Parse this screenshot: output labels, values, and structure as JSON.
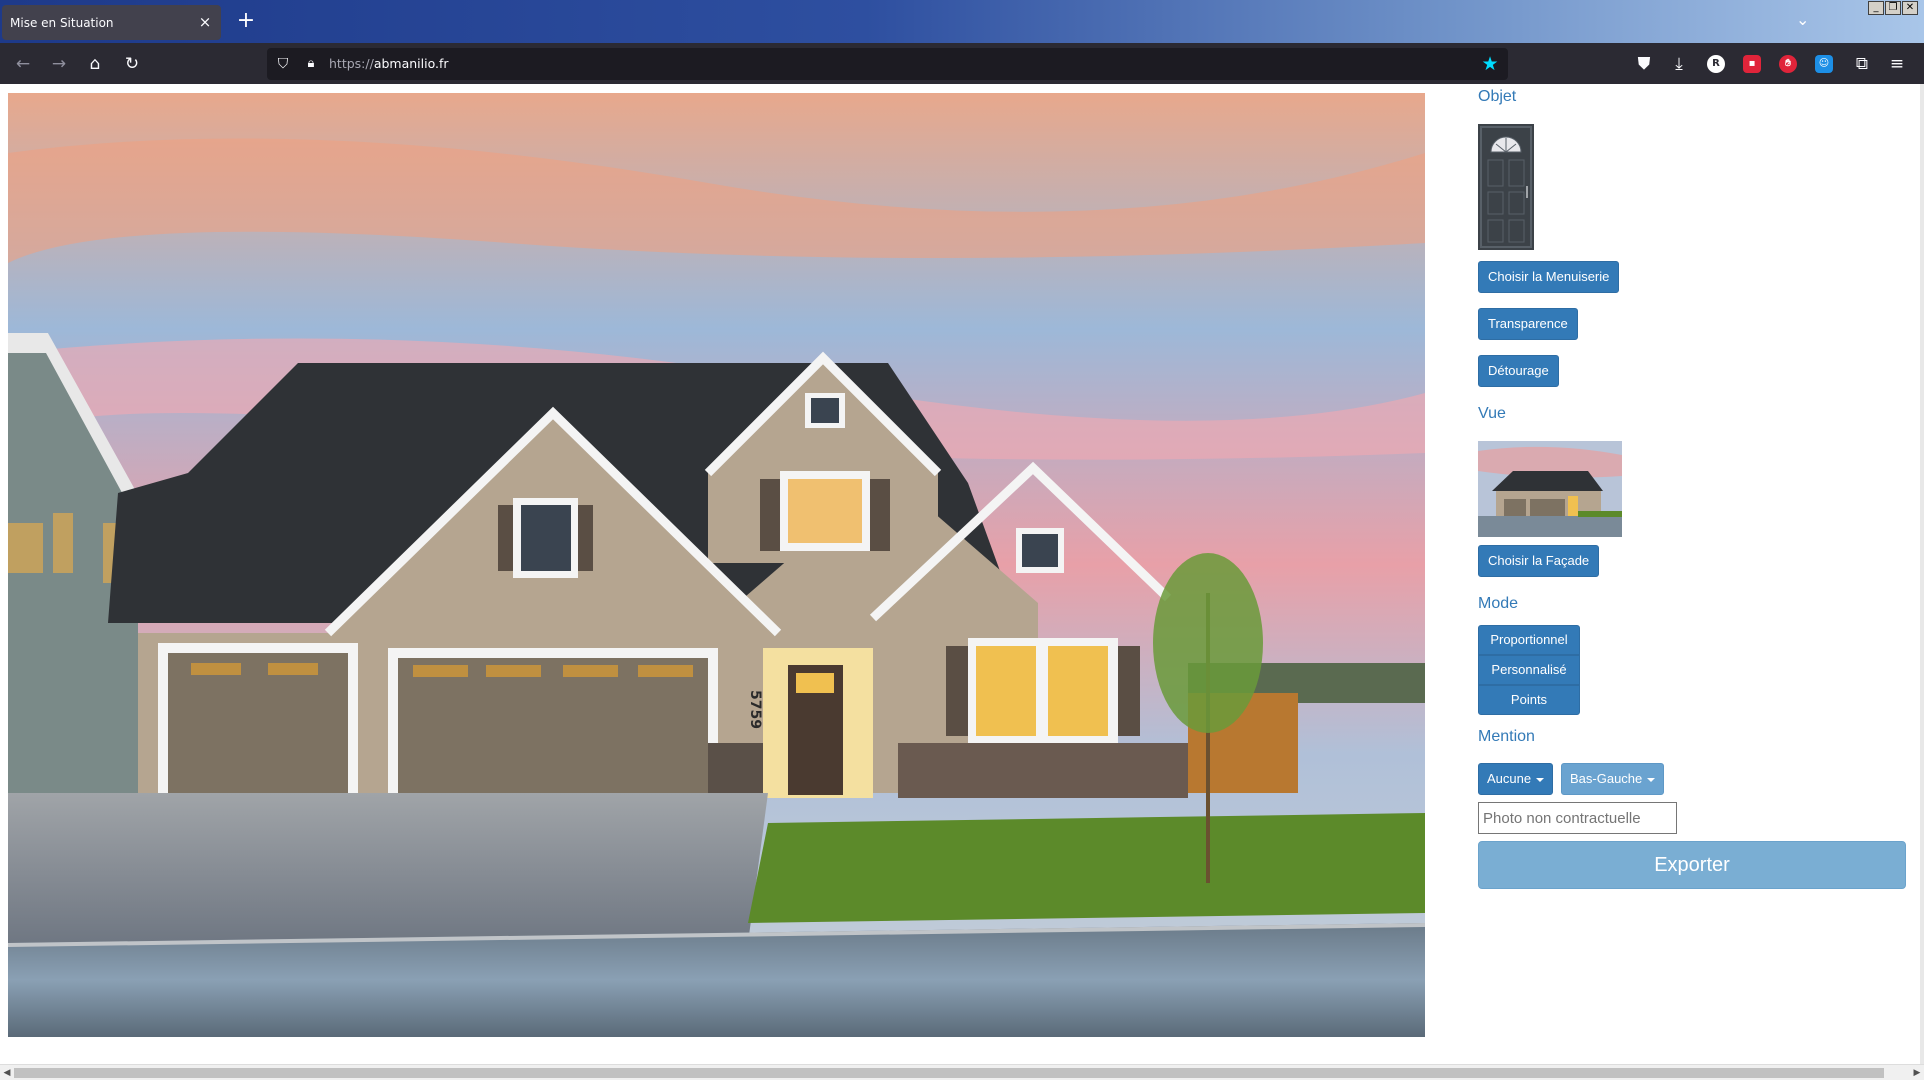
{
  "browser": {
    "tab_title": "Mise en Situation",
    "tab_close": "×",
    "new_tab": "+",
    "url_scheme": "https://",
    "url_host": "abmanilio.fr",
    "extension_letter": "R"
  },
  "panel": {
    "objet_label": "Objet",
    "choose_joinery": "Choisir la Menuiserie",
    "transparency": "Transparence",
    "clipping": "Détourage",
    "vue_label": "Vue",
    "choose_facade": "Choisir la Façade",
    "mode_label": "Mode",
    "modes": [
      "Proportionnel",
      "Personnalisé",
      "Points"
    ],
    "mention_label": "Mention",
    "mention_type": "Aucune",
    "mention_position": "Bas-Gauche",
    "mention_placeholder": "Photo non contractuelle",
    "export": "Exporter"
  },
  "scene": {
    "house_number": "5759"
  },
  "colors": {
    "primary": "#337ab7",
    "export_disabled": "#7aaed3",
    "url_star": "#00ddff"
  }
}
